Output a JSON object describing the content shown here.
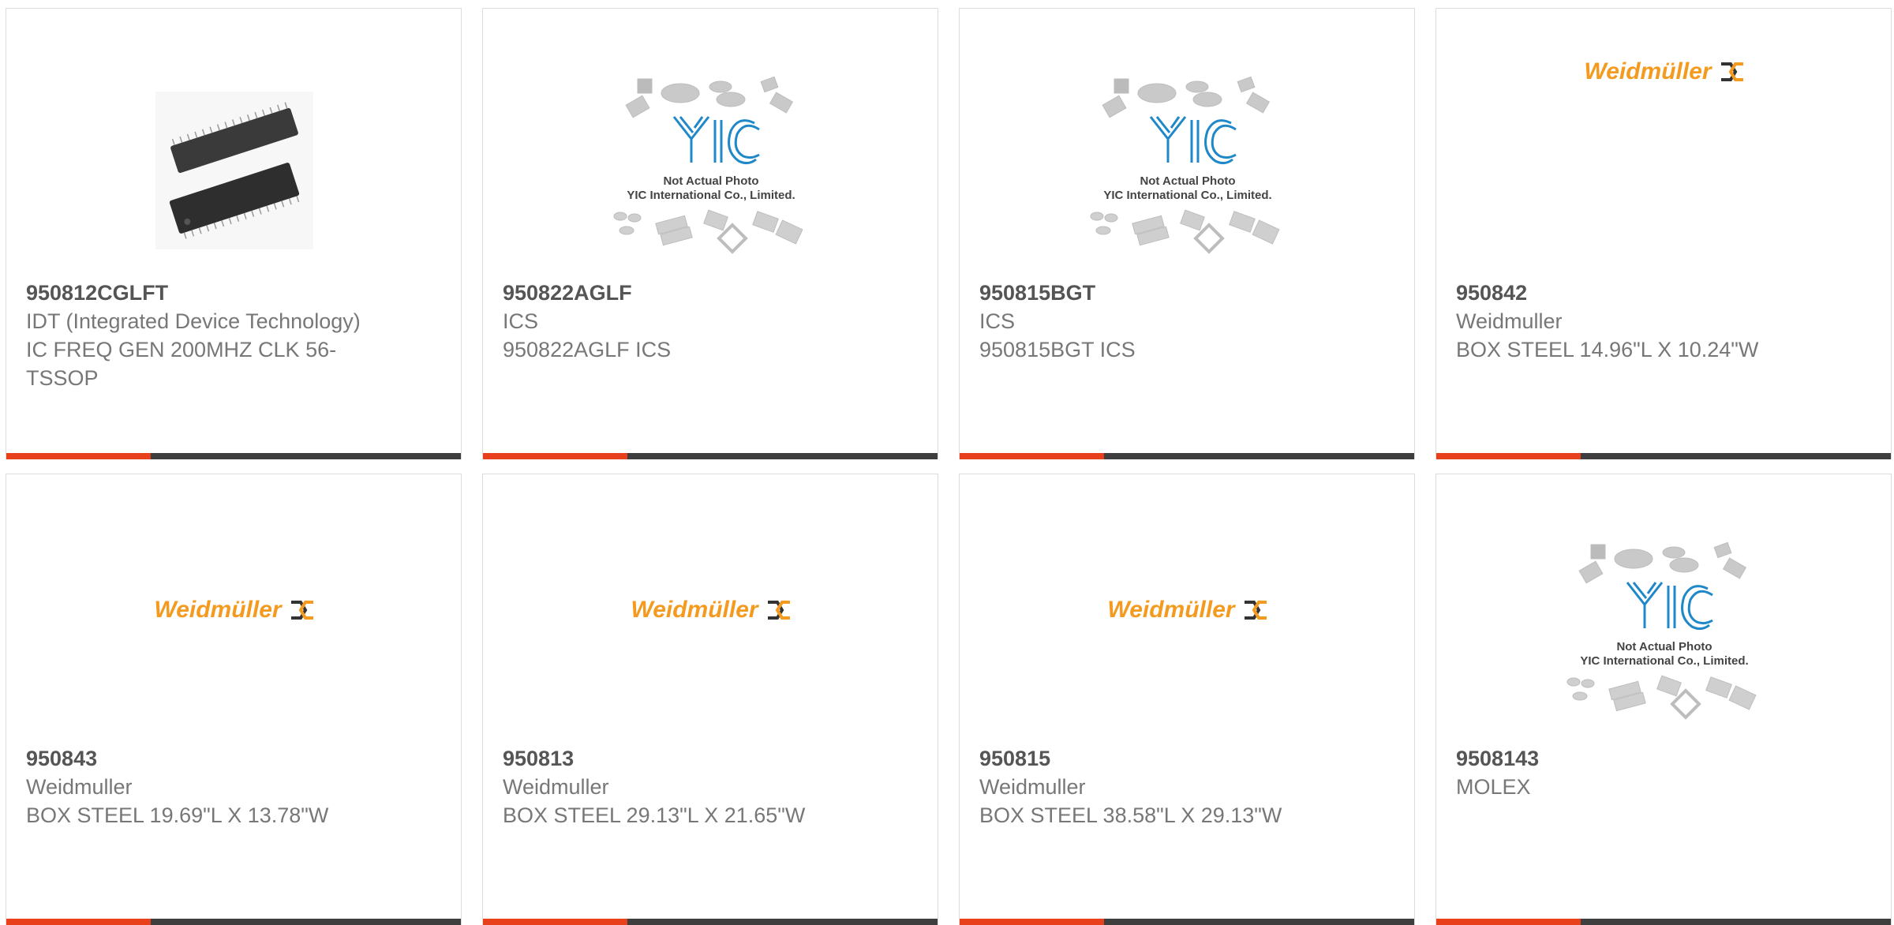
{
  "accent_color": "#e8401b",
  "bar_color": "#3e3e3e",
  "products": [
    {
      "part": "950812CGLFT",
      "manufacturer": "IDT (Integrated Device Technology)",
      "description": "IC FREQ GEN 200MHZ CLK 56-TSSOP",
      "image": "chip-photo"
    },
    {
      "part": "950822AGLF",
      "manufacturer": "ICS",
      "description": "950822AGLF ICS",
      "image": "yic-placeholder",
      "placeholder_line1": "Not Actual Photo",
      "placeholder_line2": "YIC International Co., Limited."
    },
    {
      "part": "950815BGT",
      "manufacturer": "ICS",
      "description": "950815BGT ICS",
      "image": "yic-placeholder",
      "placeholder_line1": "Not Actual Photo",
      "placeholder_line2": "YIC International Co., Limited."
    },
    {
      "part": "950842",
      "manufacturer": "Weidmuller",
      "description": "BOX STEEL 14.96\"L X 10.24\"W",
      "image": "weidmuller-logo",
      "logo_text": "Weidmüller"
    },
    {
      "part": "950843",
      "manufacturer": "Weidmuller",
      "description": "BOX STEEL 19.69\"L X 13.78\"W",
      "image": "weidmuller-logo",
      "logo_text": "Weidmüller"
    },
    {
      "part": "950813",
      "manufacturer": "Weidmuller",
      "description": "BOX STEEL 29.13\"L X 21.65\"W",
      "image": "weidmuller-logo",
      "logo_text": "Weidmüller"
    },
    {
      "part": "950815",
      "manufacturer": "Weidmuller",
      "description": "BOX STEEL 38.58\"L X 29.13\"W",
      "image": "weidmuller-logo",
      "logo_text": "Weidmüller"
    },
    {
      "part": "9508143",
      "manufacturer": "MOLEX",
      "description": "",
      "image": "yic-placeholder",
      "placeholder_line1": "Not Actual Photo",
      "placeholder_line2": "YIC International Co., Limited."
    }
  ]
}
